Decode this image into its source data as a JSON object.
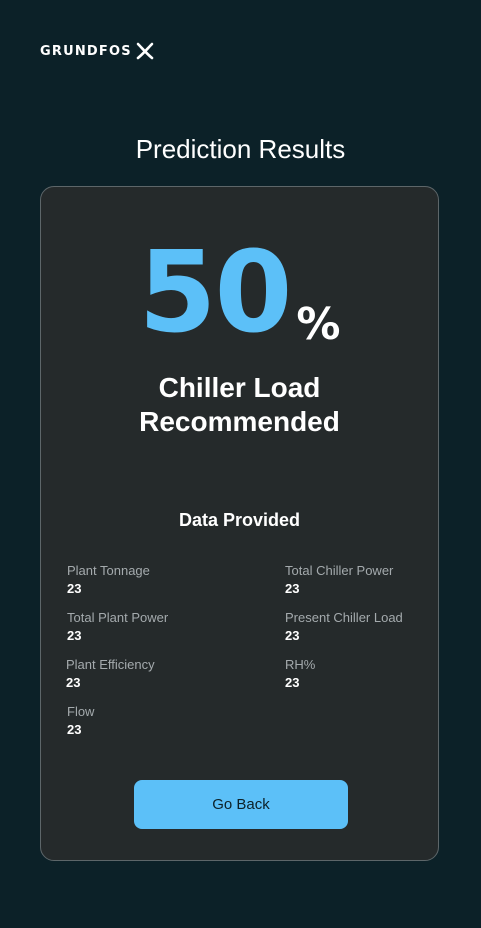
{
  "header": {
    "logo_text": "GRUNDFOS"
  },
  "page": {
    "title": "Prediction Results"
  },
  "result": {
    "value": "50",
    "unit": "%",
    "label_line1": "Chiller Load",
    "label_line2": "Recommended"
  },
  "data_section": {
    "title": "Data Provided",
    "items": [
      {
        "label": "Plant Tonnage",
        "value": "23"
      },
      {
        "label": "Total Chiller Power",
        "value": "23"
      },
      {
        "label": "Total Plant Power",
        "value": "23"
      },
      {
        "label": "Present Chiller Load",
        "value": "23"
      },
      {
        "label": "Plant Efficiency",
        "value": "23"
      },
      {
        "label": "RH%",
        "value": "23"
      },
      {
        "label": "Flow",
        "value": "23"
      }
    ]
  },
  "actions": {
    "back_label": "Go Back"
  },
  "colors": {
    "background": "#0c2128",
    "card": "#252a2b",
    "accent": "#5cc0f8"
  }
}
